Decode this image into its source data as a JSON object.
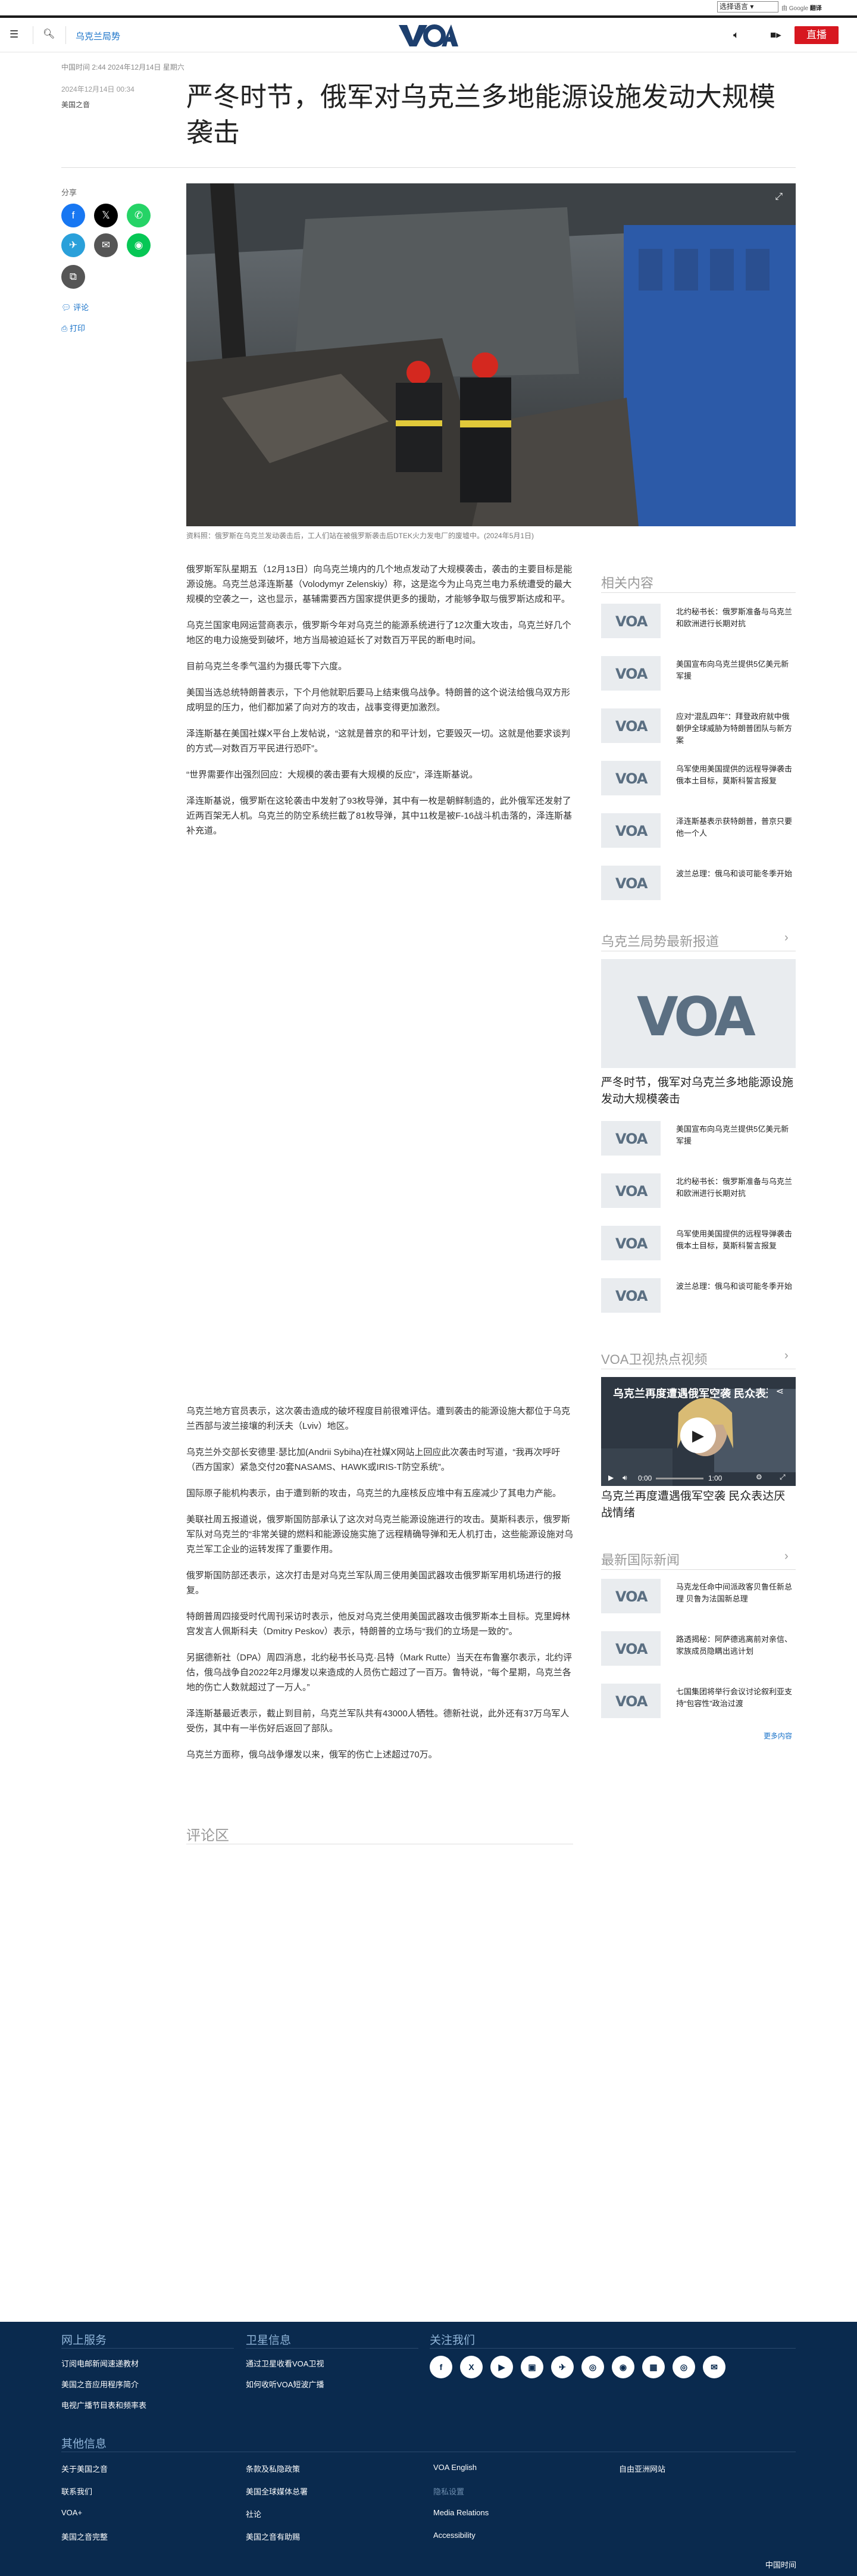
{
  "topbar": {
    "language_select": "选择语言",
    "translate_powered": "由 Google 翻译提供支持",
    "translate_label_google": "由",
    "translate_label_brand": "翻译"
  },
  "header": {
    "section": "乌克兰局势",
    "logo": "VOA",
    "live_label": "直播"
  },
  "article": {
    "date_line": "中国时间 2:44 2024年12月14日 星期六",
    "date_published": "2024年12月14日 00:34",
    "byline": "美国之音",
    "title": "严冬时节，俄军对乌克兰多地能源设施发动大规模袭击",
    "share_label": "分享",
    "comment_label": "评论",
    "print_label": "打印",
    "hero_caption": "资料照：俄罗斯在乌克兰发动袭击后，工人们站在被俄罗斯袭击后DTEK火力发电厂的废墟中。(2024年5月1日)",
    "paragraphs": [
      "俄罗斯军队星期五（12月13日）向乌克兰境内的几个地点发动了大规模袭击，袭击的主要目标是能源设施。乌克兰总泽连斯基（Volodymyr Zelenskiy）称，这是迄今为止乌克兰电力系统遭受的最大规模的空袭之一，这也显示，基辅需要西方国家提供更多的援助，才能够争取与俄罗斯达成和平。",
      "乌克兰国家电网运营商表示，俄罗斯今年对乌克兰的能源系统进行了12次重大攻击，乌克兰好几个地区的电力设施受到破坏，地方当局被迫延长了对数百万平民的断电时间。",
      "目前乌克兰冬季气温约为摄氏零下六度。",
      "美国当选总统特朗普表示，下个月他就职后要马上结束俄乌战争。特朗普的这个说法给俄乌双方形成明显的压力，他们都加紧了向对方的攻击，战事变得更加激烈。",
      "泽连斯基在美国社媒X平台上发帖说，“这就是普京的和平计划，它要毁灭一切。这就是他要求谈判的方式—对数百万平民进行恐吓”。",
      "“世界需要作出强烈回应：大规模的袭击要有大规模的反应”，泽连斯基说。",
      "泽连斯基说，俄罗斯在这轮袭击中发射了93枚导弹，其中有一枚是朝鲜制造的，此外俄军还发射了近两百架无人机。乌克兰的防空系统拦截了81枚导弹，其中11枚是被F-16战斗机击落的，泽连斯基补充道。"
    ],
    "paragraphs2": [
      "乌克兰地方官员表示，这次袭击造成的破坏程度目前很难评估。遭到袭击的能源设施大都位于乌克兰西部与波兰接壤的利沃夫（Lviv）地区。",
      "乌克兰外交部长安德里·瑟比加(Andrii Sybiha)在社媒X网站上回应此次袭击时写道，“我再次呼吁（西方国家）紧急交付20套NASAMS、HAWK或IRIS-T防空系统”。",
      "国际原子能机构表示，由于遭到新的攻击，乌克兰的九座核反应堆中有五座减少了其电力产能。",
      "美联社周五报道说，俄罗斯国防部承认了这次对乌克兰能源设施进行的攻击。莫斯科表示，俄罗斯军队对乌克兰的“非常关键的燃料和能源设施实施了远程精确导弹和无人机打击，这些能源设施对乌克兰军工企业的运转发挥了重要作用。",
      "俄罗斯国防部还表示，这次打击是对乌克兰军队周三使用美国武器攻击俄罗斯军用机场进行的报复。",
      "特朗普周四接受时代周刊采访时表示，他反对乌克兰使用美国武器攻击俄罗斯本土目标。克里姆林宫发言人佩斯科夫（Dmitry Peskov）表示，特朗普的立场与“我们的立场是一致的”。",
      "另据德新社（DPA）周四消息，北约秘书长马克·吕特（Mark Rutte）当天在布鲁塞尔表示，北约评估，俄乌战争自2022年2月爆发以来造成的人员伤亡超过了一百万。鲁特说，“每个星期，乌克兰各地的伤亡人数就超过了一万人。”",
      "泽连斯基最近表示，截止到目前，乌克兰军队共有43000人牺牲。德新社说，此外还有37万乌军人受伤，其中有一半伤好后返回了部队。",
      "乌克兰方面称，俄乌战争爆发以来，俄军的伤亡上述超过70万。"
    ],
    "comments_zone": "评论区"
  },
  "sidebar": {
    "related_title": "相关内容",
    "related": [
      "北约秘书长：俄罗斯准备与乌克兰和欧洲进行长期对抗",
      "美国宣布向乌克兰提供5亿美元新军援",
      "应对“混乱四年”：拜登政府就中俄朝伊全球威胁为特朗普团队与新方案",
      "乌军使用美国提供的远程导弹袭击俄本土目标，莫斯科誓言报复",
      "泽连斯基表示获特朗普，普京只要他一个人",
      "波兰总理：俄乌和谈可能冬季开始"
    ],
    "latest_title": "乌克兰局势最新报道",
    "featured_title": "严冬时节，俄军对乌克兰多地能源设施发动大规模袭击",
    "latest": [
      "美国宣布向乌克兰提供5亿美元新军援",
      "北约秘书长：俄罗斯准备与乌克兰和欧洲进行长期对抗",
      "乌军使用美国提供的远程导弹袭击俄本土目标，莫斯科誓言报复",
      "波兰总理：俄乌和谈可能冬季开始"
    ],
    "video_section": "VOA卫视热点视频",
    "video_title": "乌克兰再度遭遇俄军空袭 民众表达...",
    "video_caption": "乌克兰再度遭遇俄军空袭 民众表达厌战情绪",
    "video_time": "0:00",
    "video_duration": "1:00",
    "world_title": "最新国际新闻",
    "world": [
      "马克龙任命中间派政客贝鲁任新总理 贝鲁为法国新总理",
      "路透揭秘：阿萨德逃离前对亲信、家族成员隐瞒出逃计划",
      "七国集团将举行会议讨论叙利亚支持“包容性”政治过渡"
    ],
    "more_label": "更多内容"
  },
  "footer": {
    "col1_title": "网上服务",
    "col1": [
      "订阅电邮新闻速递教材",
      "美国之音应用程序简介",
      "电视广播节目表和频率表"
    ],
    "col2_title": "卫星信息",
    "col2": [
      "通过卫星收看VOA卫视",
      "如何收听VOA短波广播"
    ],
    "col3_title": "关注我们",
    "social": [
      "f",
      "X",
      "▶",
      "▣",
      "✈",
      "◎",
      "◉",
      "▦",
      "◎",
      "✉"
    ],
    "other_title": "其他信息",
    "links": [
      [
        "关于美国之音",
        "条款及私隐政策",
        "VOA English",
        "自由亚洲网站"
      ],
      [
        "联系我们",
        "美国全球媒体总署",
        "隐私设置",
        ""
      ],
      [
        "VOA+",
        "社论",
        "Media Relations",
        ""
      ],
      [
        "美国之音完整",
        "美国之音有助赐",
        "Accessibility",
        ""
      ]
    ],
    "timezone": "中国时间"
  }
}
